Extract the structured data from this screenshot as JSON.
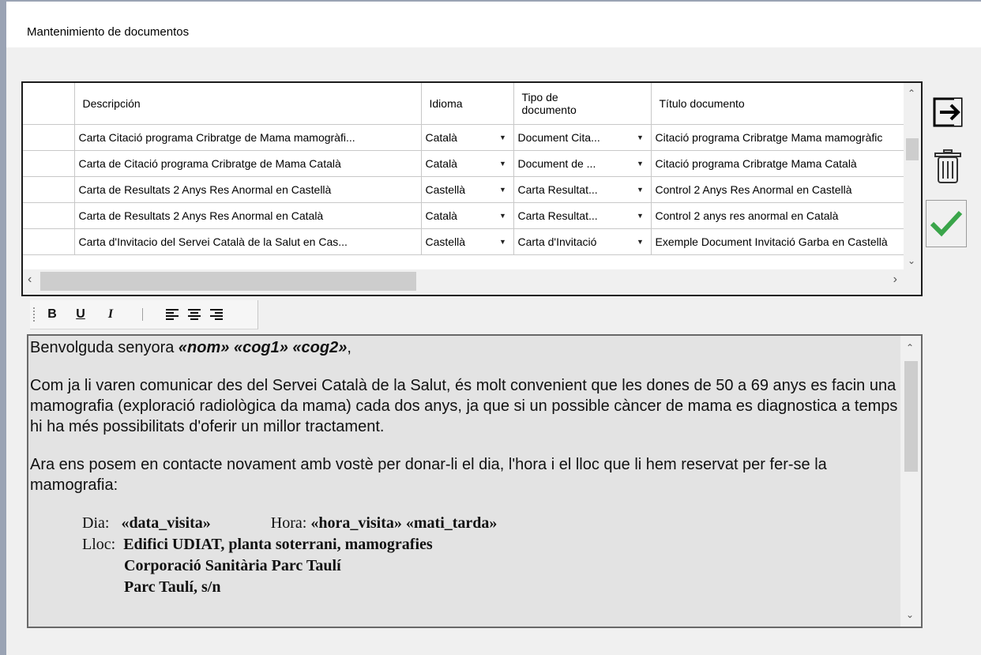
{
  "window": {
    "title": "Mantenimiento de documentos"
  },
  "grid": {
    "columns": [
      "",
      "Descripción",
      "Idioma",
      "Tipo de documento",
      "Título documento"
    ],
    "rows": [
      {
        "descripcion": "Carta Citació programa Cribratge de Mama mamogràfi...",
        "idioma": "Català",
        "tipo": "Document Cita...",
        "titulo": "Citació programa Cribratge Mama mamogràfic"
      },
      {
        "descripcion": "Carta de Citació programa Cribratge de Mama Català",
        "idioma": "Català",
        "tipo": "Document de ...",
        "titulo": "Citació programa Cribratge Mama Català"
      },
      {
        "descripcion": "Carta de Resultats 2 Anys Res Anormal en Castellà",
        "idioma": "Castellà",
        "tipo": "Carta Resultat...",
        "titulo": "Control 2 Anys Res Anormal en Castellà"
      },
      {
        "descripcion": "Carta de Resultats 2 Anys Res Anormal en Català",
        "idioma": "Català",
        "tipo": "Carta Resultat...",
        "titulo": "Control 2 anys res anormal  en Català"
      },
      {
        "descripcion": "Carta d'Invitacio del Servei Català de la Salut  en Cas...",
        "idioma": "Castellà",
        "tipo": "Carta d'Invitació",
        "titulo": "Exemple Document Invitació Garba en Castellà"
      }
    ]
  },
  "toolbar": {
    "bold": "B",
    "underline": "U",
    "italic": "I"
  },
  "document": {
    "greeting_prefix": "Benvolguda senyora ",
    "greeting_fields": "«nom» «cog1» «cog2»",
    "greeting_suffix": ",",
    "para1": "Com ja li varen comunicar des del  Servei Català de la Salut, és molt convenient que les dones de 50 a 69 anys es facin una mamografia (exploració radiològica da mama) cada dos anys, ja que si un possible càncer de mama es diagnostica a temps hi ha més possibilitats d'oferir un millor tractament.",
    "para2": "Ara ens posem en contacte novament amb vostè per donar-li el dia, l'hora i el lloc que li hem reservat per fer-se la mamografia:",
    "dia_label": "Dia:",
    "dia_value": "«data_visita»",
    "hora_label": "Hora:",
    "hora_value": "«hora_visita»  «mati_tarda»",
    "lloc_label": "Lloc:",
    "lloc_line1": "Edifici UDIAT, planta soterrani, mamografies",
    "lloc_line2": "Corporació Sanitària Parc Taulí",
    "lloc_line3": "Parc Taulí, s/n"
  },
  "icons": [
    "exit-icon",
    "trash-icon",
    "checkmark-icon",
    "align-left-icon",
    "align-center-icon",
    "align-right-icon"
  ],
  "colors": {
    "accept_green": "#3aa54a",
    "window_border": "#9aa3b4"
  }
}
